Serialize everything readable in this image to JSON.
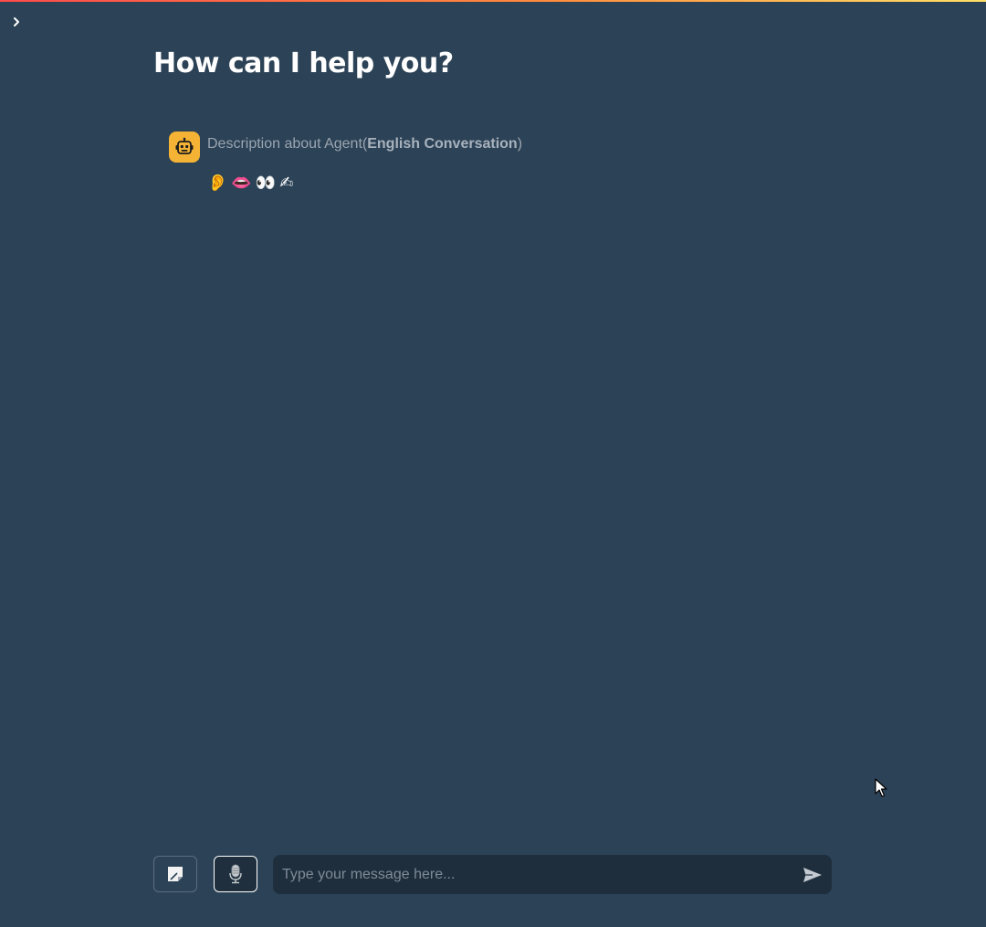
{
  "app": {
    "accent_gradient": [
      "#ff4b4b",
      "#ffe066"
    ],
    "background": "#2c4256"
  },
  "sidebar": {
    "toggle_icon": "chevron-right-icon"
  },
  "main": {
    "title": "How can I help you?"
  },
  "message": {
    "avatar_icon": "robot-icon",
    "avatar_color": "#f5b335",
    "heading_prefix": "Description about Agent(",
    "heading_bold": "English Conversation",
    "heading_suffix": ")",
    "emojis": [
      "👂",
      "👄",
      "👀",
      "✍"
    ]
  },
  "chat_input": {
    "placeholder": "Type your message here...",
    "note_button_icon": "note-icon",
    "mic_button_icon": "microphone-icon",
    "send_icon": "send-icon"
  }
}
